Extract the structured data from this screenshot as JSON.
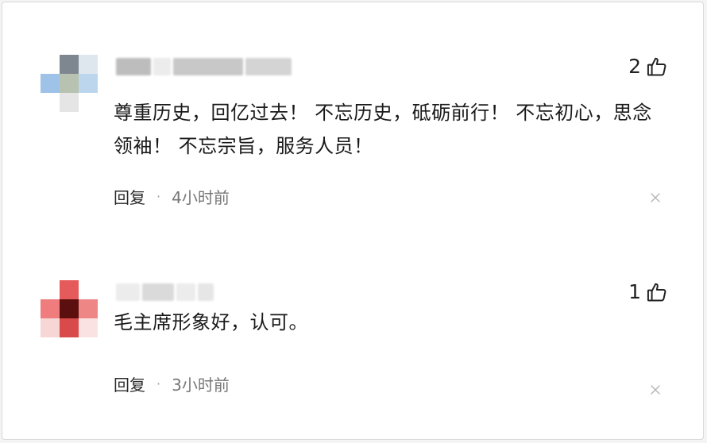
{
  "comments": [
    {
      "text": "尊重历史，回亿过去！ 不忘历史，砥砺前行！ 不忘初心，思念领袖！ 不忘宗旨，服务人员！",
      "likes": "2",
      "reply_label": "回复",
      "separator": "·",
      "time": "4小时前",
      "avatar_colors": [
        "#ffffff",
        "#7e8790",
        "#dfe7ee",
        "#9fc3e8",
        "#b7c3b0",
        "#bcd6ee",
        "#ffffff",
        "#e5e5e5",
        "#ffffff"
      ],
      "username_colors": [
        "#bdbdbd",
        "#ececec",
        "#c8c8c8",
        "#d4d4d4"
      ]
    },
    {
      "text": "毛主席形象好，认可。",
      "likes": "1",
      "reply_label": "回复",
      "separator": "·",
      "time": "3小时前",
      "avatar_colors": [
        "#ffffff",
        "#e55a5a",
        "#ffffff",
        "#ef7d7d",
        "#5c0f0f",
        "#ef8686",
        "#f7d6d6",
        "#d94a4a",
        "#fbe2e2"
      ],
      "username_colors": [
        "#ececec",
        "#dadada",
        "#ececec",
        "#e6e6e6"
      ]
    }
  ],
  "icons": {
    "like": "thumbs-up-icon",
    "close": "close-icon"
  }
}
